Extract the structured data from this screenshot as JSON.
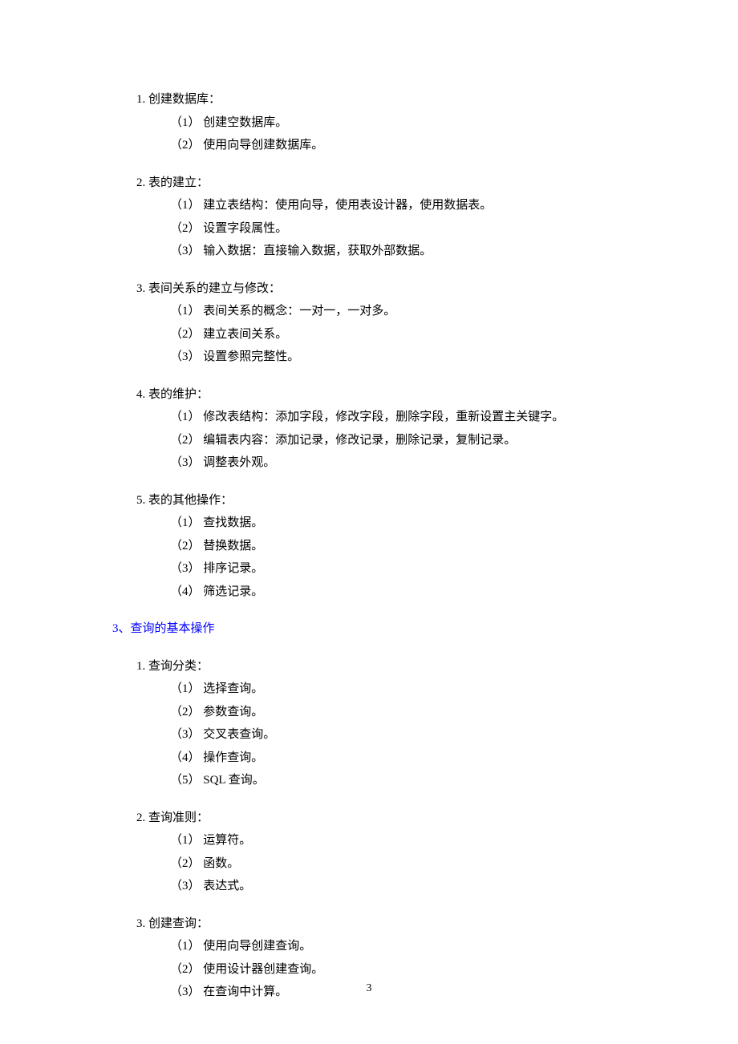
{
  "sections": [
    {
      "title": "1. 创建数据库：",
      "items": [
        "（1） 创建空数据库。",
        "（2） 使用向导创建数据库。"
      ]
    },
    {
      "title": "2. 表的建立：",
      "items": [
        "（1） 建立表结构：使用向导，使用表设计器，使用数据表。",
        "（2） 设置字段属性。",
        "（3） 输入数据：直接输入数据，获取外部数据。"
      ]
    },
    {
      "title": "3. 表间关系的建立与修改：",
      "items": [
        "（1） 表间关系的概念：一对一，一对多。",
        "（2） 建立表间关系。",
        "（3） 设置参照完整性。"
      ]
    },
    {
      "title": "4. 表的维护：",
      "items": [
        "（1） 修改表结构：添加字段，修改字段，删除字段，重新设置主关键字。",
        "（2） 编辑表内容：添加记录，修改记录，删除记录，复制记录。",
        "（3） 调整表外观。"
      ]
    },
    {
      "title": "5. 表的其他操作：",
      "items": [
        "（1） 查找数据。",
        "（2） 替换数据。",
        "（3） 排序记录。",
        "（4） 筛选记录。"
      ]
    }
  ],
  "heading": "3、查询的基本操作",
  "sections2": [
    {
      "title": "1. 查询分类：",
      "items": [
        "（1） 选择查询。",
        "（2） 参数查询。",
        "（3） 交叉表查询。",
        "（4） 操作查询。",
        "（5） SQL 查询。"
      ]
    },
    {
      "title": "2. 查询准则：",
      "items": [
        "（1） 运算符。",
        "（2） 函数。",
        "（3） 表达式。"
      ]
    },
    {
      "title": "3. 创建查询：",
      "items": [
        "（1） 使用向导创建查询。",
        "（2） 使用设计器创建查询。",
        "（3） 在查询中计算。"
      ]
    }
  ],
  "pageNumber": "3"
}
